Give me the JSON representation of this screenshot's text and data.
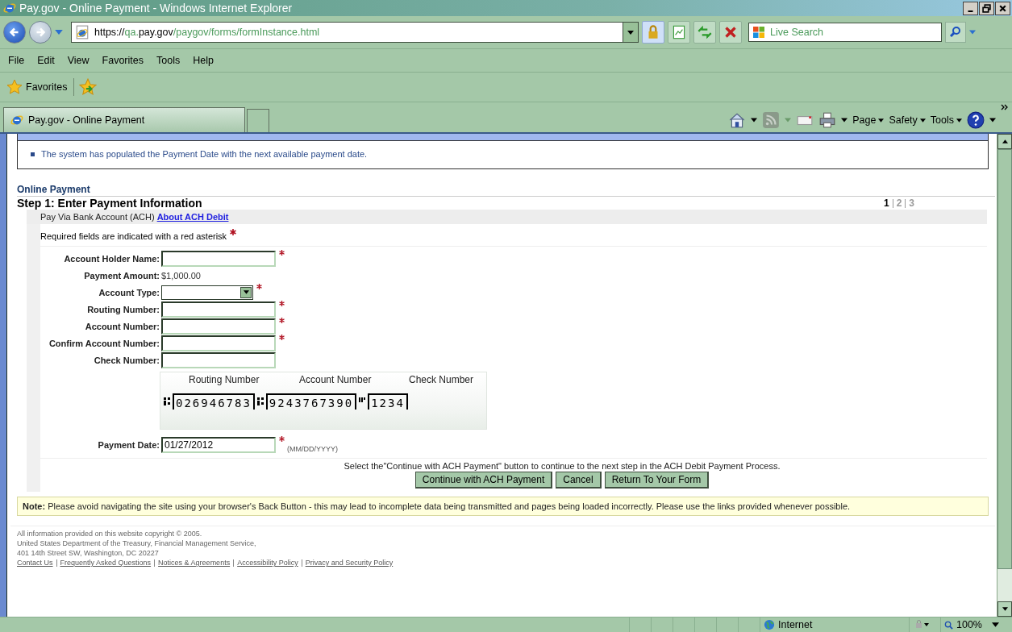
{
  "window": {
    "title": "Pay.gov - Online Payment - Windows Internet Explorer"
  },
  "address_bar": {
    "url_parts": [
      {
        "text": "https://",
        "emphasized": true
      },
      {
        "text": "qa.",
        "emphasized": false
      },
      {
        "text": "pay.gov",
        "emphasized": true
      },
      {
        "text": "/paygov/forms/formInstance.html",
        "emphasized": false
      }
    ]
  },
  "search": {
    "placeholder": "Live Search"
  },
  "menu": [
    "File",
    "Edit",
    "View",
    "Favorites",
    "Tools",
    "Help"
  ],
  "favorites_bar": {
    "label": "Favorites"
  },
  "tabs": [
    {
      "label": "Pay.gov - Online Payment",
      "selected": true
    }
  ],
  "command_bar": [
    "Page",
    "Safety",
    "Tools"
  ],
  "system_message": {
    "items": [
      "The system has populated the Payment Date with the next available payment date."
    ]
  },
  "section_title": "Online Payment",
  "step_title": "Step 1: Enter Payment Information",
  "steps": [
    {
      "label": "1",
      "selected": true
    },
    {
      "label": "2",
      "selected": false
    },
    {
      "label": "3",
      "selected": false
    }
  ],
  "payment_method": {
    "label": "Pay Via Bank Account (ACH)",
    "link": "About ACH Debit"
  },
  "required_note": "Required fields are indicated with a red asterisk",
  "fields": [
    {
      "kind": "text",
      "label": "Account Holder Name:",
      "required": true
    },
    {
      "kind": "static",
      "label": "Payment Amount:",
      "value": "$1,000.00",
      "required": false
    },
    {
      "kind": "select",
      "label": "Account Type:",
      "required": true
    },
    {
      "kind": "text",
      "label": "Routing Number:",
      "required": true
    },
    {
      "kind": "text",
      "label": "Account Number:",
      "required": true
    },
    {
      "kind": "text",
      "label": "Confirm Account Number:",
      "required": true
    },
    {
      "kind": "text",
      "label": "Check Number:",
      "required": false
    }
  ],
  "check_image": {
    "labels": [
      "Routing Number",
      "Account Number",
      "Check Number"
    ],
    "routing": "026946783",
    "account": "9243767390",
    "check": "1234"
  },
  "payment_date": {
    "label": "Payment Date:",
    "value": "01/27/2012",
    "required": true,
    "hint": "(MM/DD/YYYY)"
  },
  "instruction": "Select the\"Continue with ACH Payment\" button to continue to the next step in the ACH Debit Payment Process.",
  "buttons": [
    "Continue with ACH Payment",
    "Cancel",
    "Return To Your Form"
  ],
  "note": "**Note:** Please avoid navigating the site using your browser's Back Button - this may lead to incomplete data being transmitted and pages being loaded incorrectly. Please use the links provided whenever possible.",
  "footer": {
    "lines": [
      "All information provided on this website copyright © 2005.",
      "United States Department of the Treasury, Financial Management Service,",
      "401 14th Street SW, Washington, DC 20227"
    ],
    "links": [
      "Contact Us",
      "Frequently Asked Questions",
      "Notices & Agreements",
      "Accessibility Policy",
      "Privacy and Security Policy"
    ]
  },
  "status_bar": {
    "zone": "Internet",
    "zoom": "100%"
  }
}
